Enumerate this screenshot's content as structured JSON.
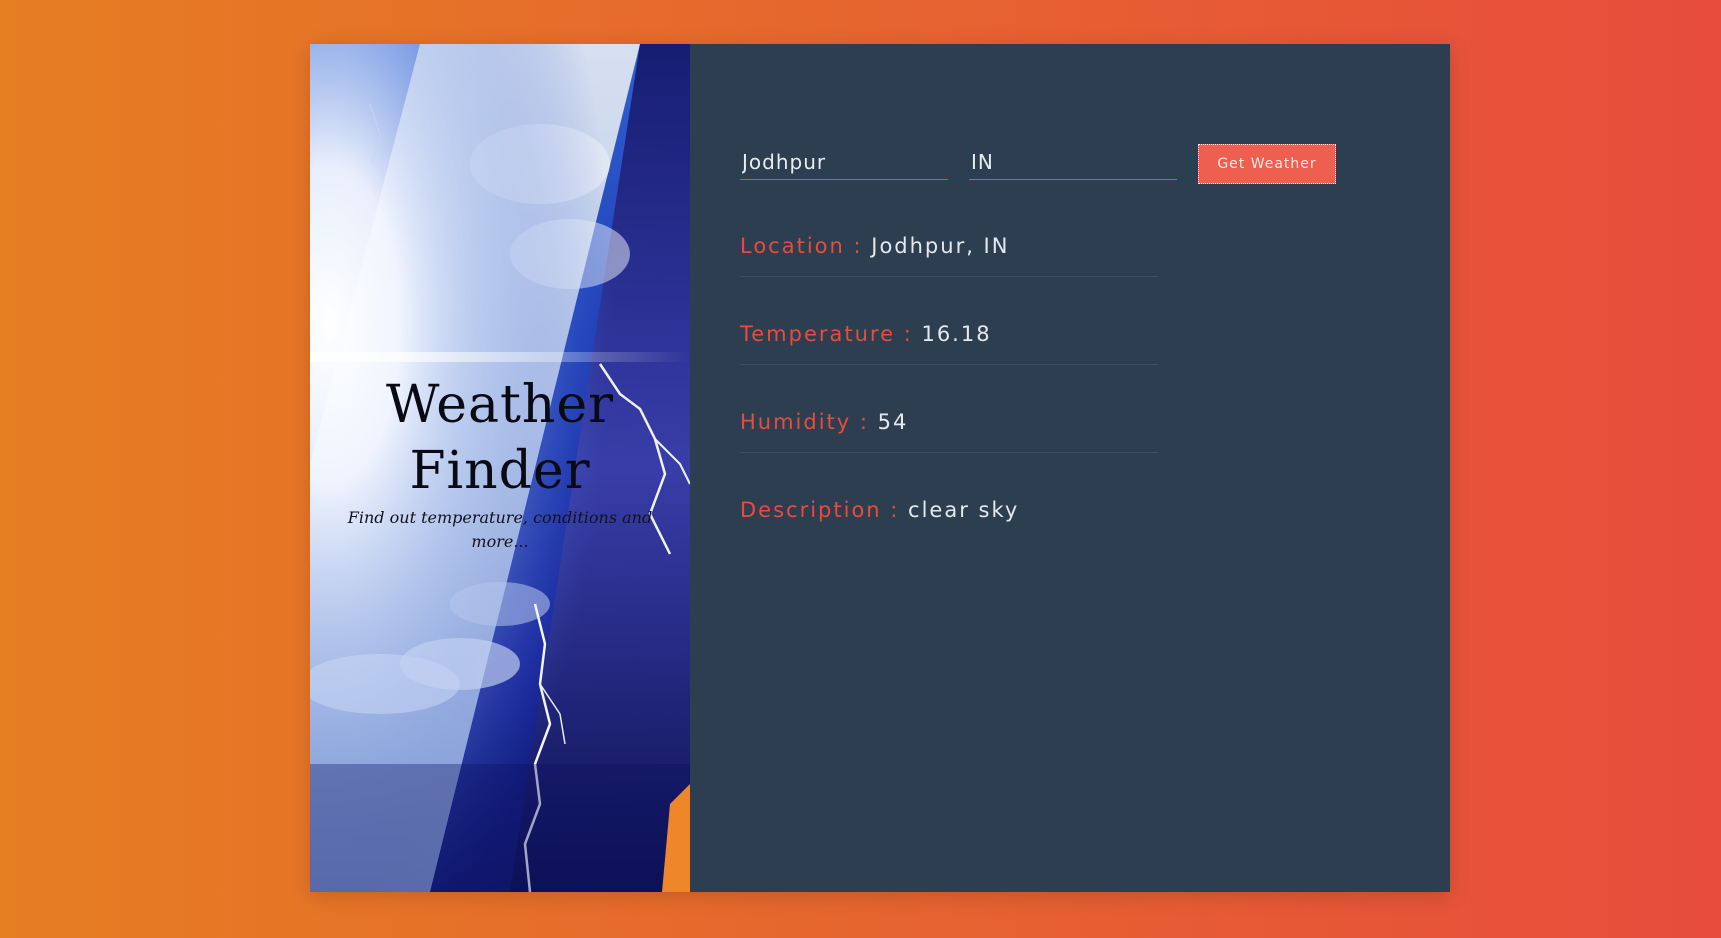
{
  "hero": {
    "title_line1": "Weather",
    "title_line2": "Finder",
    "subtitle": "Find out temperature, conditions and more..."
  },
  "form": {
    "city_value": "Jodhpur",
    "country_value": "IN",
    "button_label": "Get Weather"
  },
  "results": {
    "location": {
      "label": "Location : ",
      "value": "Jodhpur, IN"
    },
    "temperature": {
      "label": "Temperature : ",
      "value": "16.18"
    },
    "humidity": {
      "label": "Humidity : ",
      "value": "54"
    },
    "description": {
      "label": "Description : ",
      "value": "clear sky"
    }
  },
  "colors": {
    "background_start": "#e67e22",
    "background_end": "#e74c3c",
    "panel": "#2c3e50",
    "accent": "#e74c3c"
  }
}
